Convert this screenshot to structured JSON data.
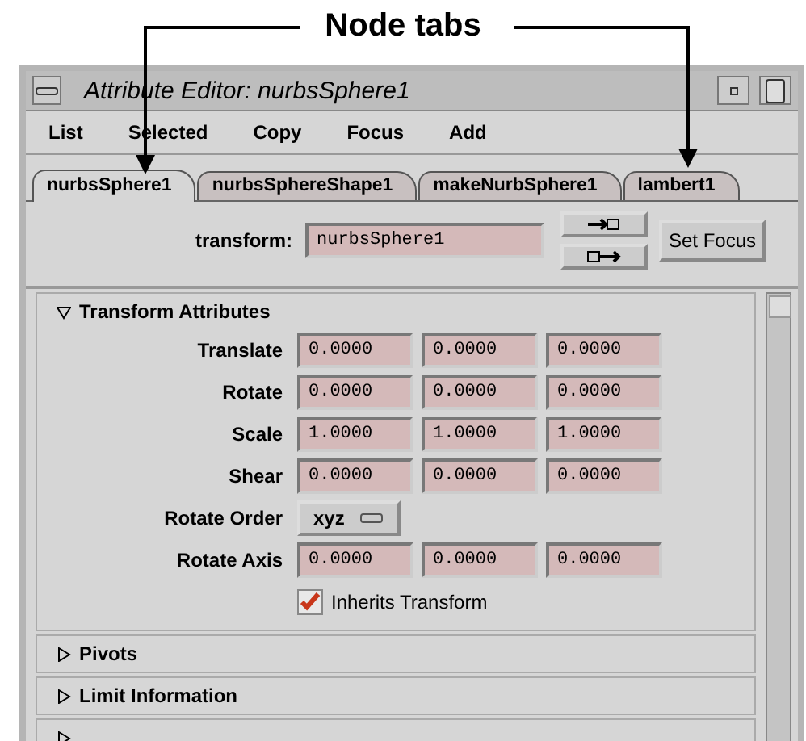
{
  "callout": {
    "label": "Node tabs"
  },
  "window": {
    "title": "Attribute Editor: nurbsSphere1"
  },
  "menu": [
    "List",
    "Selected",
    "Copy",
    "Focus",
    "Add"
  ],
  "tabs": [
    {
      "label": "nurbsSphere1",
      "selected": true
    },
    {
      "label": "nurbsSphereShape1",
      "selected": false
    },
    {
      "label": "makeNurbSphere1",
      "selected": false
    },
    {
      "label": "lambert1",
      "selected": false
    }
  ],
  "transform": {
    "label": "transform:",
    "value": "nurbsSphere1",
    "focus_button": "Set Focus"
  },
  "sections": [
    {
      "title": "Transform Attributes",
      "expanded": true,
      "rows": [
        {
          "kind": "vector",
          "label": "Translate",
          "values": [
            "0.0000",
            "0.0000",
            "0.0000"
          ]
        },
        {
          "kind": "vector",
          "label": "Rotate",
          "values": [
            "0.0000",
            "0.0000",
            "0.0000"
          ]
        },
        {
          "kind": "vector",
          "label": "Scale",
          "values": [
            "1.0000",
            "1.0000",
            "1.0000"
          ]
        },
        {
          "kind": "vector",
          "label": "Shear",
          "values": [
            "0.0000",
            "0.0000",
            "0.0000"
          ]
        },
        {
          "kind": "option",
          "label": "Rotate Order",
          "value": "xyz"
        },
        {
          "kind": "vector",
          "label": "Rotate Axis",
          "values": [
            "0.0000",
            "0.0000",
            "0.0000"
          ]
        },
        {
          "kind": "checkbox",
          "label": "Inherits Transform",
          "checked": true
        }
      ]
    },
    {
      "title": "Pivots",
      "expanded": false
    },
    {
      "title": "Limit Information",
      "expanded": false
    },
    {
      "expanded": false
    }
  ]
}
